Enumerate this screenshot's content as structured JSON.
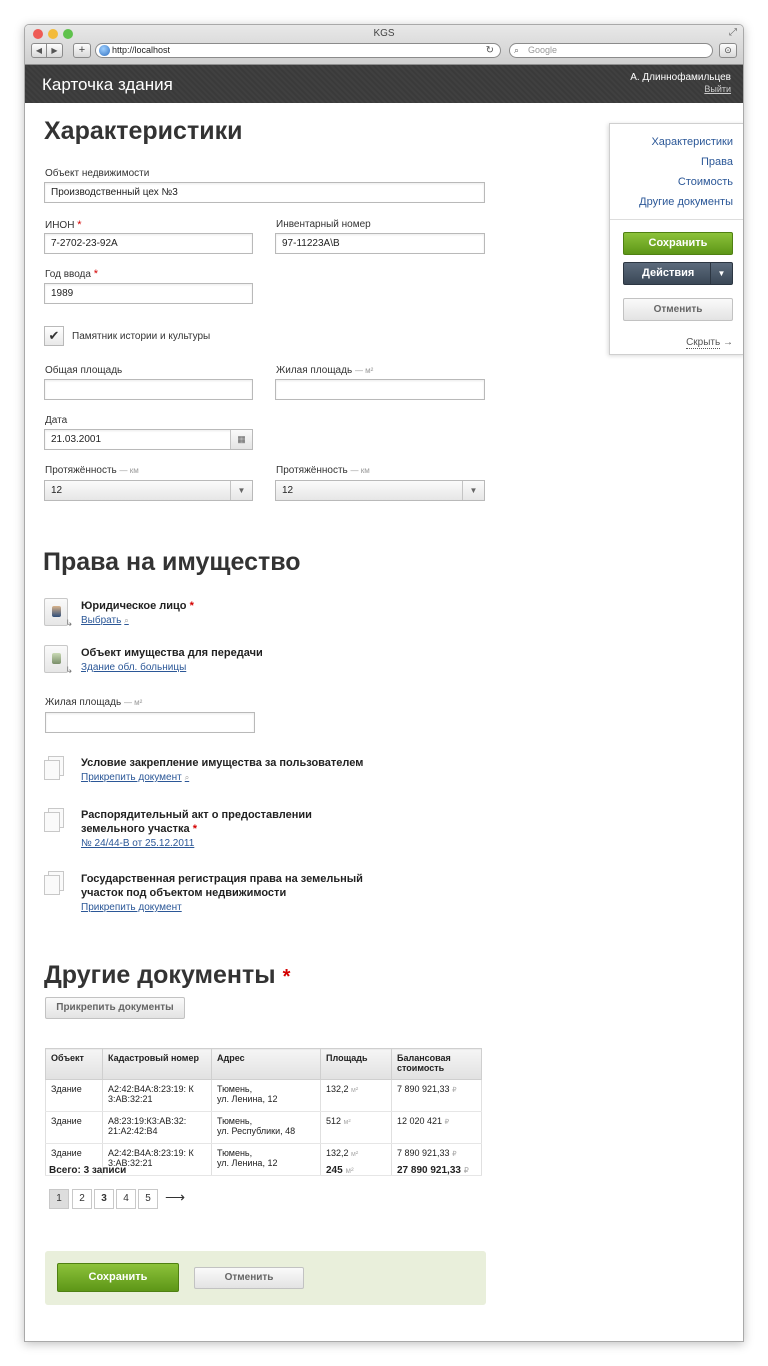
{
  "browser": {
    "window_title": "KGS",
    "url": "http://localhost",
    "search_placeholder": "Google"
  },
  "app": {
    "title": "Карточка здания",
    "user_name": "А. Длиннофамильцев",
    "logout": "Выйти"
  },
  "sidebar": {
    "links": [
      "Характеристики",
      "Права",
      "Стоимость",
      "Другие документы"
    ],
    "save": "Сохранить",
    "actions": "Действия",
    "cancel": "Отменить",
    "hide": "Скрыть"
  },
  "characteristics": {
    "heading": "Характеристики",
    "object_label": "Объект недвижимости",
    "object_value": "Производственный цех №3",
    "inon_label": "ИНОН",
    "inon_value": "7-2702-23-92А",
    "inventory_label": "Инвентарный номер",
    "inventory_value": "97-11223А\\В",
    "year_label": "Год ввода",
    "year_value": "1989",
    "monument_label": "Памятник истории и культуры",
    "monument_checked": true,
    "total_area_label": "Общая площадь",
    "total_area_value": "",
    "living_area_label": "Жилая площадь",
    "living_area_unit": "— м²",
    "living_area_value": "",
    "date_label": "Дата",
    "date_value": "21.03.2001",
    "length_label": "Протяжённость",
    "length_unit": "— км",
    "length_value": "12",
    "length2_label": "Протяжённость",
    "length2_unit": "— км",
    "length2_value": "12"
  },
  "rights": {
    "heading": "Права на имущество",
    "legal_entity_title": "Юридическое лицо",
    "legal_entity_link": "Выбрать",
    "transfer_title": "Объект имущества для передачи",
    "transfer_link": "Здание обл. больницы",
    "living_area_label": "Жилая площадь",
    "living_area_unit": "— м²",
    "living_area_value": "",
    "doc1_title": "Условие закрепление имущества за пользователем",
    "doc1_link": "Прикрепить документ",
    "doc2_title_line1": "Распорядительный акт о предоставлении",
    "doc2_title_line2": "земельного участка",
    "doc2_link": "№ 24/44-В от 25.12.2011",
    "doc3_title_line1": "Государственная регистрация права на земельный",
    "doc3_title_line2": "участок под объектом недвижимости",
    "doc3_link": "Прикрепить документ"
  },
  "other_docs": {
    "heading": "Другие документы",
    "attach_button": "Прикрепить документы",
    "columns": [
      "Объект",
      "Кадастровый номер",
      "Адрес",
      "Площадь",
      "Балансовая стоимость"
    ],
    "rows": [
      {
        "object": "Здание",
        "cadastral": "А2:42:В4А:8:23:19: К 3:АВ:32:21",
        "address_1": "Тюмень,",
        "address_2": "ул. Ленина, 12",
        "area": "132,2",
        "area_unit": "м²",
        "value": "7 890 921,33",
        "currency": "₽"
      },
      {
        "object": "Здание",
        "cadastral": "А8:23:19:К3:АВ:32: 21:А2:42:В4",
        "address_1": "Тюмень,",
        "address_2": "ул. Республики, 48",
        "area": "512",
        "area_unit": "м²",
        "value": "12 020 421",
        "currency": "₽"
      },
      {
        "object": "Здание",
        "cadastral": "А2:42:В4А:8:23:19: К 3:АВ:32:21",
        "address_1": "Тюмень,",
        "address_2": "ул. Ленина, 12",
        "area": "132,2",
        "area_unit": "м²",
        "value": "7 890 921,33",
        "currency": "₽"
      }
    ],
    "total_label": "Всего: 3 записи",
    "total_area": "245",
    "total_area_unit": "м²",
    "total_value": "27 890 921,33",
    "total_currency": "₽",
    "pages": [
      "1",
      "2",
      "3",
      "4",
      "5"
    ],
    "next_arrow": "⟶"
  },
  "footer": {
    "save": "Сохранить",
    "cancel": "Отменить"
  },
  "colors": {
    "accent_green": "#6aa21f",
    "link_blue": "#2b5797",
    "required_red": "#d40000",
    "appbar_dark": "#3b3b3b"
  }
}
